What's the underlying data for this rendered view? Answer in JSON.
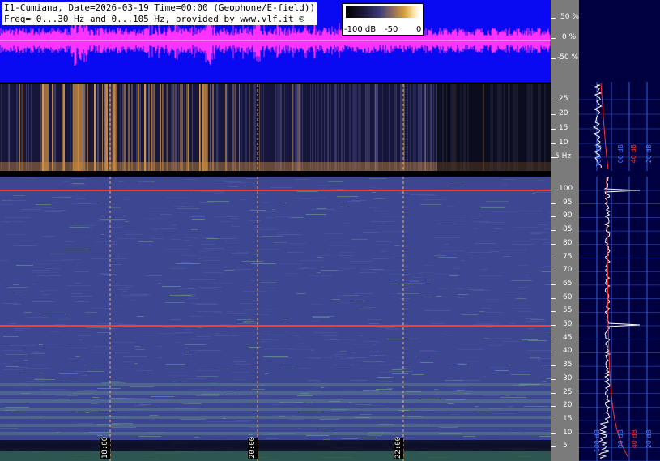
{
  "header": {
    "title_line1": "I1-Cumiana, Date=2026-03-19 Time=00:00 (Geophone/E-field))",
    "title_line2": "Freq= 0...30 Hz and 0...105 Hz, provided by www.vlf.it ©"
  },
  "colorbar": {
    "labels": [
      "-100 dB",
      "-50",
      "0"
    ]
  },
  "amplitude_axis": {
    "ticks": [
      "50 %",
      "0 %",
      "-50 %"
    ]
  },
  "low_freq_axis": {
    "ticks": [
      "25",
      "20",
      "15",
      "10",
      "5 Hz"
    ]
  },
  "main_freq_axis": {
    "ticks": [
      "100",
      "95",
      "90",
      "85",
      "80",
      "75",
      "70",
      "65",
      "60",
      "55",
      "50",
      "45",
      "40",
      "35",
      "30",
      "25",
      "20",
      "15",
      "10",
      "5"
    ]
  },
  "time_markers": [
    "18:00",
    "20:00",
    "22:00"
  ],
  "spectrum_panel": {
    "upper_labels": [
      "100 dB",
      "00 dB",
      "40 dB",
      "20 dB"
    ],
    "lower_labels": [
      "100 dB",
      "00 dB",
      "40 dB",
      "20 dB"
    ]
  },
  "colors": {
    "waveform_bg": "#0a0af2",
    "waveform_trace": "#ff33ff",
    "marker_line": "#ffb070",
    "mains_line": "#ff3a2a"
  }
}
